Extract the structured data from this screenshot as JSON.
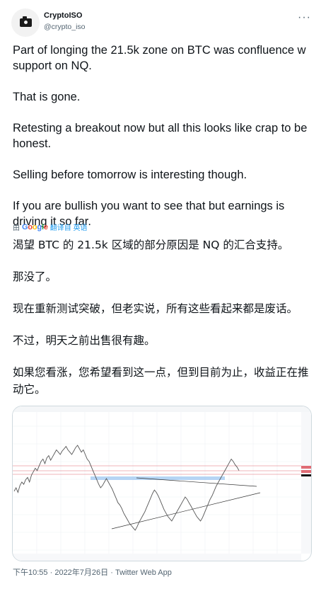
{
  "author": {
    "name": "CryptoISO",
    "handle": "@crypto_iso",
    "avatar_icon": "camera-icon",
    "more_icon": "more-icon"
  },
  "tweet": {
    "paragraphs": [
      "Part of longing the 21.5k zone on BTC was confluence w support on NQ.",
      "That is gone.",
      "Retesting a breakout now but all this looks like crap to be honest.",
      "Selling before tomorrow is interesting though.",
      "If you are bullish you want to see that but earnings is driving it so far."
    ]
  },
  "translation": {
    "by_label": "由",
    "provider": "Google",
    "action": "翻译自 英语",
    "paragraphs": [
      "渴望 BTC 的 21.5k 区域的部分原因是 NQ 的汇合支持。",
      "那没了。",
      "现在重新测试突破，但老实说，所有这些看起来都是废话。",
      "不过，明天之前出售很有趣。",
      "如果您看涨，您希望看到这一点，但到目前为止，收益正在推动它。"
    ]
  },
  "meta": {
    "time": "下午10:55",
    "separator": "·",
    "date": "2022年7月26日",
    "via": "Twitter Web App"
  },
  "colors": {
    "link": "#1d9bf0",
    "secondary_text": "#536471",
    "price_line": "#555555",
    "support_zone": "#9ec7f0",
    "resistance_lines": "#e06c75"
  },
  "chart_data": {
    "type": "line",
    "title": "",
    "xlabel": "",
    "ylabel": "",
    "series": [
      {
        "values": [
          52,
          55,
          51,
          57,
          60,
          58,
          62,
          64,
          60,
          66,
          69,
          72,
          70,
          74,
          78,
          80,
          76,
          81,
          83,
          79,
          82,
          85,
          88,
          86,
          84,
          87,
          89,
          91,
          88,
          86,
          84,
          87,
          90,
          92,
          89,
          86,
          88,
          84,
          80,
          78,
          74,
          70,
          66,
          62,
          58,
          55,
          57,
          60,
          63,
          60,
          57,
          54,
          50,
          46,
          42,
          40,
          37,
          33,
          30,
          27,
          24,
          22,
          20,
          18,
          21,
          25,
          28,
          31,
          34,
          38,
          42,
          46,
          50,
          53,
          51,
          48,
          44,
          40,
          36,
          33,
          30,
          28,
          26,
          29,
          32,
          35,
          38,
          41,
          44,
          47,
          45,
          42,
          39,
          36,
          33,
          30,
          28,
          26,
          29,
          33,
          37,
          41,
          45,
          48,
          52,
          56,
          59,
          62,
          65,
          68,
          71,
          74,
          77,
          80,
          78,
          75,
          73,
          70
        ]
      }
    ]
  }
}
